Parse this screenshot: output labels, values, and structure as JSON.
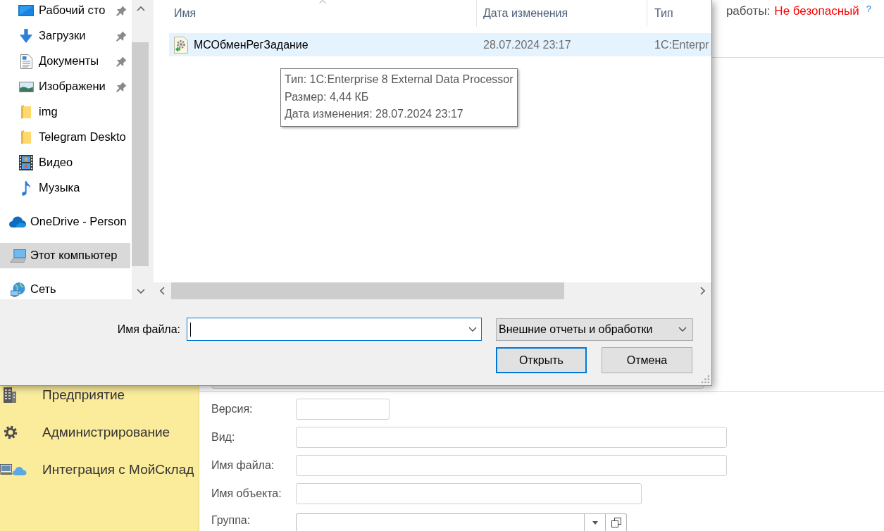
{
  "file_dialog": {
    "navigation": {
      "tree": [
        {
          "children": [
            {
              "label": "Рабочий сто",
              "kind": "desktop",
              "pinned": true,
              "selected": false
            },
            {
              "label": "Загрузки",
              "kind": "downloads",
              "pinned": true,
              "selected": false
            },
            {
              "label": "Документы",
              "kind": "documents",
              "pinned": true,
              "selected": false
            },
            {
              "label": "Изображени",
              "kind": "pictures",
              "pinned": true,
              "selected": false
            },
            {
              "label": "img",
              "kind": "folder",
              "pinned": false,
              "selected": false
            },
            {
              "label": "Telegram Deskto",
              "kind": "folder",
              "pinned": false,
              "selected": false
            },
            {
              "label": "Видео",
              "kind": "videos",
              "pinned": false,
              "selected": false
            },
            {
              "label": "Музыка",
              "kind": "music",
              "pinned": false,
              "selected": false
            }
          ]
        },
        {
          "label": "OneDrive - Person",
          "kind": "cloud",
          "pinned": false,
          "selected": false
        },
        {
          "label": "Этот компьютер",
          "kind": "computer",
          "pinned": false,
          "selected": true
        },
        {
          "label": "Сеть",
          "kind": "network",
          "pinned": false,
          "selected": false
        }
      ]
    },
    "file_list": {
      "columns": [
        {
          "label": "Имя",
          "sorted": true
        },
        {
          "label": "Дата изменения",
          "sorted": false
        },
        {
          "label": "Тип",
          "sorted": false
        }
      ],
      "rows": [
        {
          "name": "МСОбменРегЗадание",
          "modified": "28.07.2024 23:17",
          "type": "1C:Enterpr",
          "selected": true
        }
      ],
      "tooltip": {
        "lines": [
          "Тип: 1C:Enterprise 8 External Data Processor",
          "Размер: 4,44 КБ",
          "Дата изменения: 28.07.2024 23:17"
        ]
      }
    },
    "file_name": {
      "label": "Имя файла:",
      "focused": true
    },
    "file_type": {
      "value": "Внешние отчеты и обработки"
    },
    "buttons": [
      {
        "label": "Открыть",
        "default": true
      },
      {
        "label": "Отмена",
        "default": false
      }
    ]
  },
  "app": {
    "status": {
      "label": "работы:",
      "value": "Не безопасный",
      "help": "?"
    },
    "sidebar": {
      "items": [
        {
          "label": "Предприятие",
          "kind": "enterprise"
        },
        {
          "label": "Администрирование",
          "kind": "administration"
        },
        {
          "label": "Интеграция с МойСклад",
          "kind": "integration"
        }
      ]
    },
    "form": {
      "fields": [
        {
          "label": "Версия:",
          "kind": "short"
        },
        {
          "label": "Вид:",
          "kind": "wide"
        },
        {
          "label": "Имя файла:",
          "kind": "wide"
        },
        {
          "label": "Имя объекта:",
          "kind": "medium"
        },
        {
          "label": "Группа:",
          "kind": "choice"
        }
      ]
    }
  }
}
